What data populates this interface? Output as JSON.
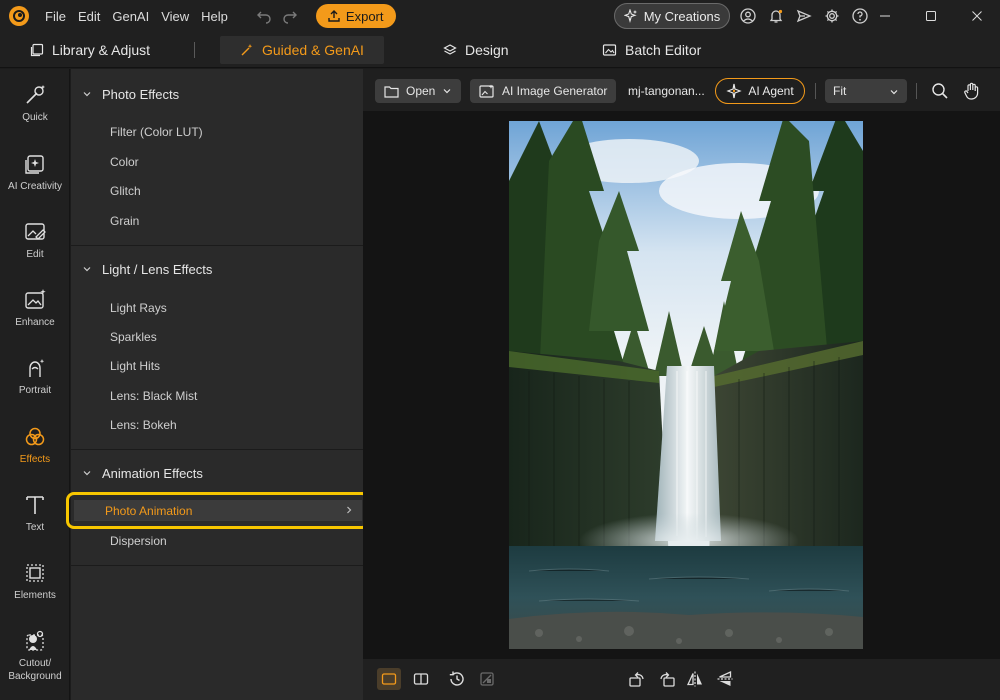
{
  "menu": [
    "File",
    "Edit",
    "GenAI",
    "View",
    "Help"
  ],
  "export_label": "Export",
  "my_creations_label": "My Creations",
  "tabs": {
    "library": "Library & Adjust",
    "guided": "Guided & GenAI",
    "design": "Design",
    "batch": "Batch Editor"
  },
  "rail": [
    {
      "label": "Quick",
      "icon": "magic-wand-icon"
    },
    {
      "label": "AI Creativity",
      "icon": "ai-creativity-icon"
    },
    {
      "label": "Edit",
      "icon": "edit-image-icon"
    },
    {
      "label": "Enhance",
      "icon": "enhance-icon"
    },
    {
      "label": "Portrait",
      "icon": "portrait-icon"
    },
    {
      "label": "Effects",
      "icon": "effects-icon"
    },
    {
      "label": "Text",
      "icon": "text-icon"
    },
    {
      "label": "Elements",
      "icon": "elements-icon"
    },
    {
      "label": "Cutout/\nBackground",
      "icon": "cutout-icon"
    }
  ],
  "panel": {
    "photo_effects": {
      "title": "Photo Effects",
      "items": [
        "Filter (Color LUT)",
        "Color",
        "Glitch",
        "Grain"
      ]
    },
    "light_lens": {
      "title": "Light / Lens Effects",
      "items": [
        "Light Rays",
        "Sparkles",
        "Light Hits",
        "Lens: Black Mist",
        "Lens: Bokeh"
      ]
    },
    "animation": {
      "title": "Animation Effects",
      "selected": "Photo Animation",
      "items": [
        "Dispersion"
      ]
    }
  },
  "toolbar": {
    "open_label": "Open",
    "ai_image_generator_label": "AI Image Generator",
    "filename": "mj-tangonan...",
    "ai_agent_label": "AI Agent",
    "fit_value": "Fit"
  },
  "colors": {
    "accent": "#f39a1a",
    "highlight_box": "#f7c600"
  }
}
